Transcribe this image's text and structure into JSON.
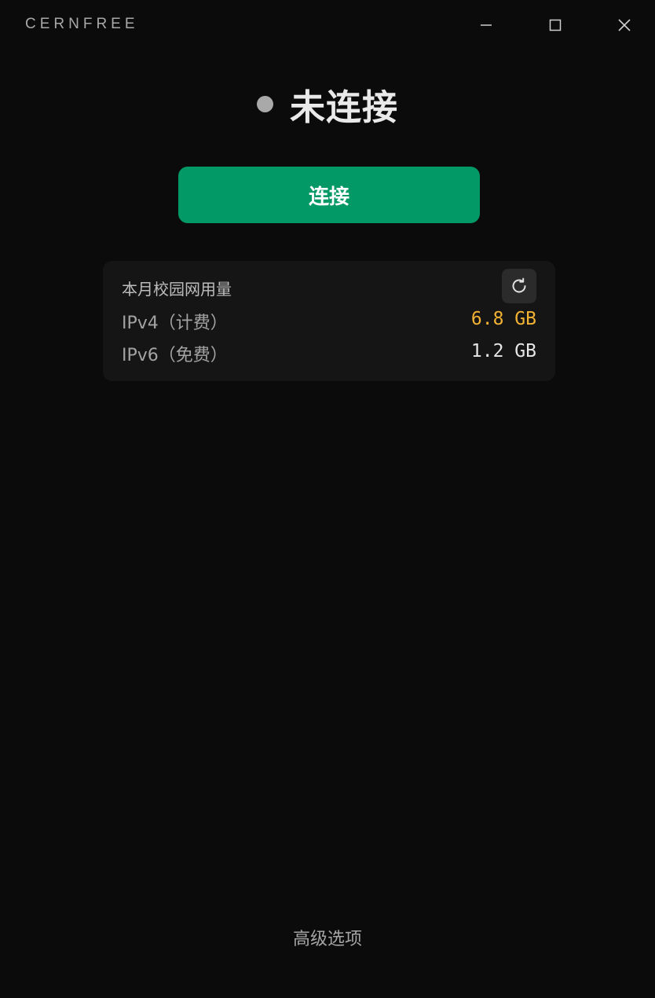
{
  "app": {
    "title": "CERNFREE"
  },
  "window_controls": {
    "minimize_icon": "minimize-icon",
    "maximize_icon": "maximize-icon",
    "close_icon": "close-icon"
  },
  "status": {
    "text": "未连接",
    "dot_color": "#a9a9a9"
  },
  "connect_button": {
    "label": "连接",
    "color": "#029966"
  },
  "usage": {
    "title": "本月校园网用量",
    "refresh_icon": "refresh-icon",
    "rows": [
      {
        "label": "IPv4（计费）",
        "value": "6.8 GB",
        "color": "#f2b233"
      },
      {
        "label": "IPv6（免费）",
        "value": "1.2 GB",
        "color": "#e6e6e6"
      }
    ]
  },
  "footer": {
    "advanced_label": "高级选项"
  }
}
